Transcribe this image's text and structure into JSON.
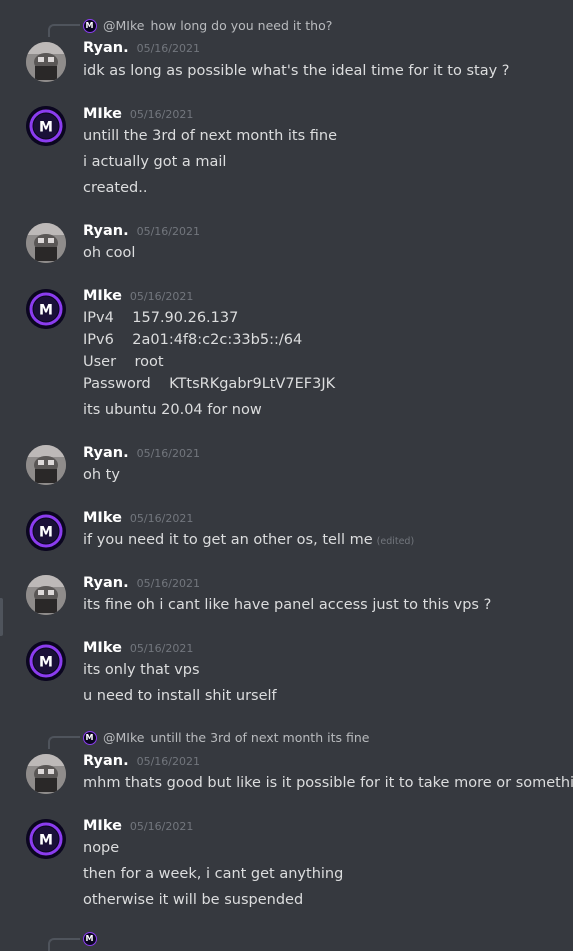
{
  "messages": [
    {
      "reply": {
        "mention": "@MIke",
        "text": "how long do you need it tho?"
      },
      "author": "Ryan.",
      "time": "05/16/2021",
      "lines": [
        "idk as long as possible what's the ideal time for it to stay  ?"
      ]
    },
    {
      "author": "MIke",
      "time": "05/16/2021",
      "lines": [
        "untill the 3rd of next month its fine",
        "i actually got a mail",
        "created.."
      ]
    },
    {
      "author": "Ryan.",
      "time": "05/16/2021",
      "lines": [
        "oh cool"
      ]
    },
    {
      "author": "MIke",
      "time": "05/16/2021",
      "lines": [
        "IPv4    157.90.26.137",
        "IPv6    2a01:4f8:c2c:33b5::/64",
        "User    root",
        "Password    KTtsRKgabr9LtV7EF3JK",
        "its ubuntu 20.04 for now"
      ]
    },
    {
      "author": "Ryan.",
      "time": "05/16/2021",
      "lines": [
        "oh ty"
      ]
    },
    {
      "author": "MIke",
      "time": "05/16/2021",
      "lines": [
        "if you need it to get an other os, tell me"
      ],
      "edited": "(edited)"
    },
    {
      "author": "Ryan.",
      "time": "05/16/2021",
      "lines": [
        "its fine oh i cant like have panel access just to this vps ?"
      ]
    },
    {
      "author": "MIke",
      "time": "05/16/2021",
      "lines": [
        "its only that vps",
        "u need to install shit urself"
      ]
    },
    {
      "reply": {
        "mention": "@MIke",
        "text": "untill the 3rd of next month its fine"
      },
      "author": "Ryan.",
      "time": "05/16/2021",
      "lines": [
        "mhm thats good but like is it possible for it to take more or something"
      ]
    },
    {
      "author": "MIke",
      "time": "05/16/2021",
      "lines": [
        "nope",
        "then for a week, i cant get anything",
        "otherwise it will be suspended"
      ]
    }
  ],
  "avatar_letter": "M",
  "colors": {
    "background": "#36393f",
    "username": "#ffffff",
    "timestamp": "#72767d",
    "text": "#dcddde",
    "mike_ring": "#8b3cf0"
  }
}
